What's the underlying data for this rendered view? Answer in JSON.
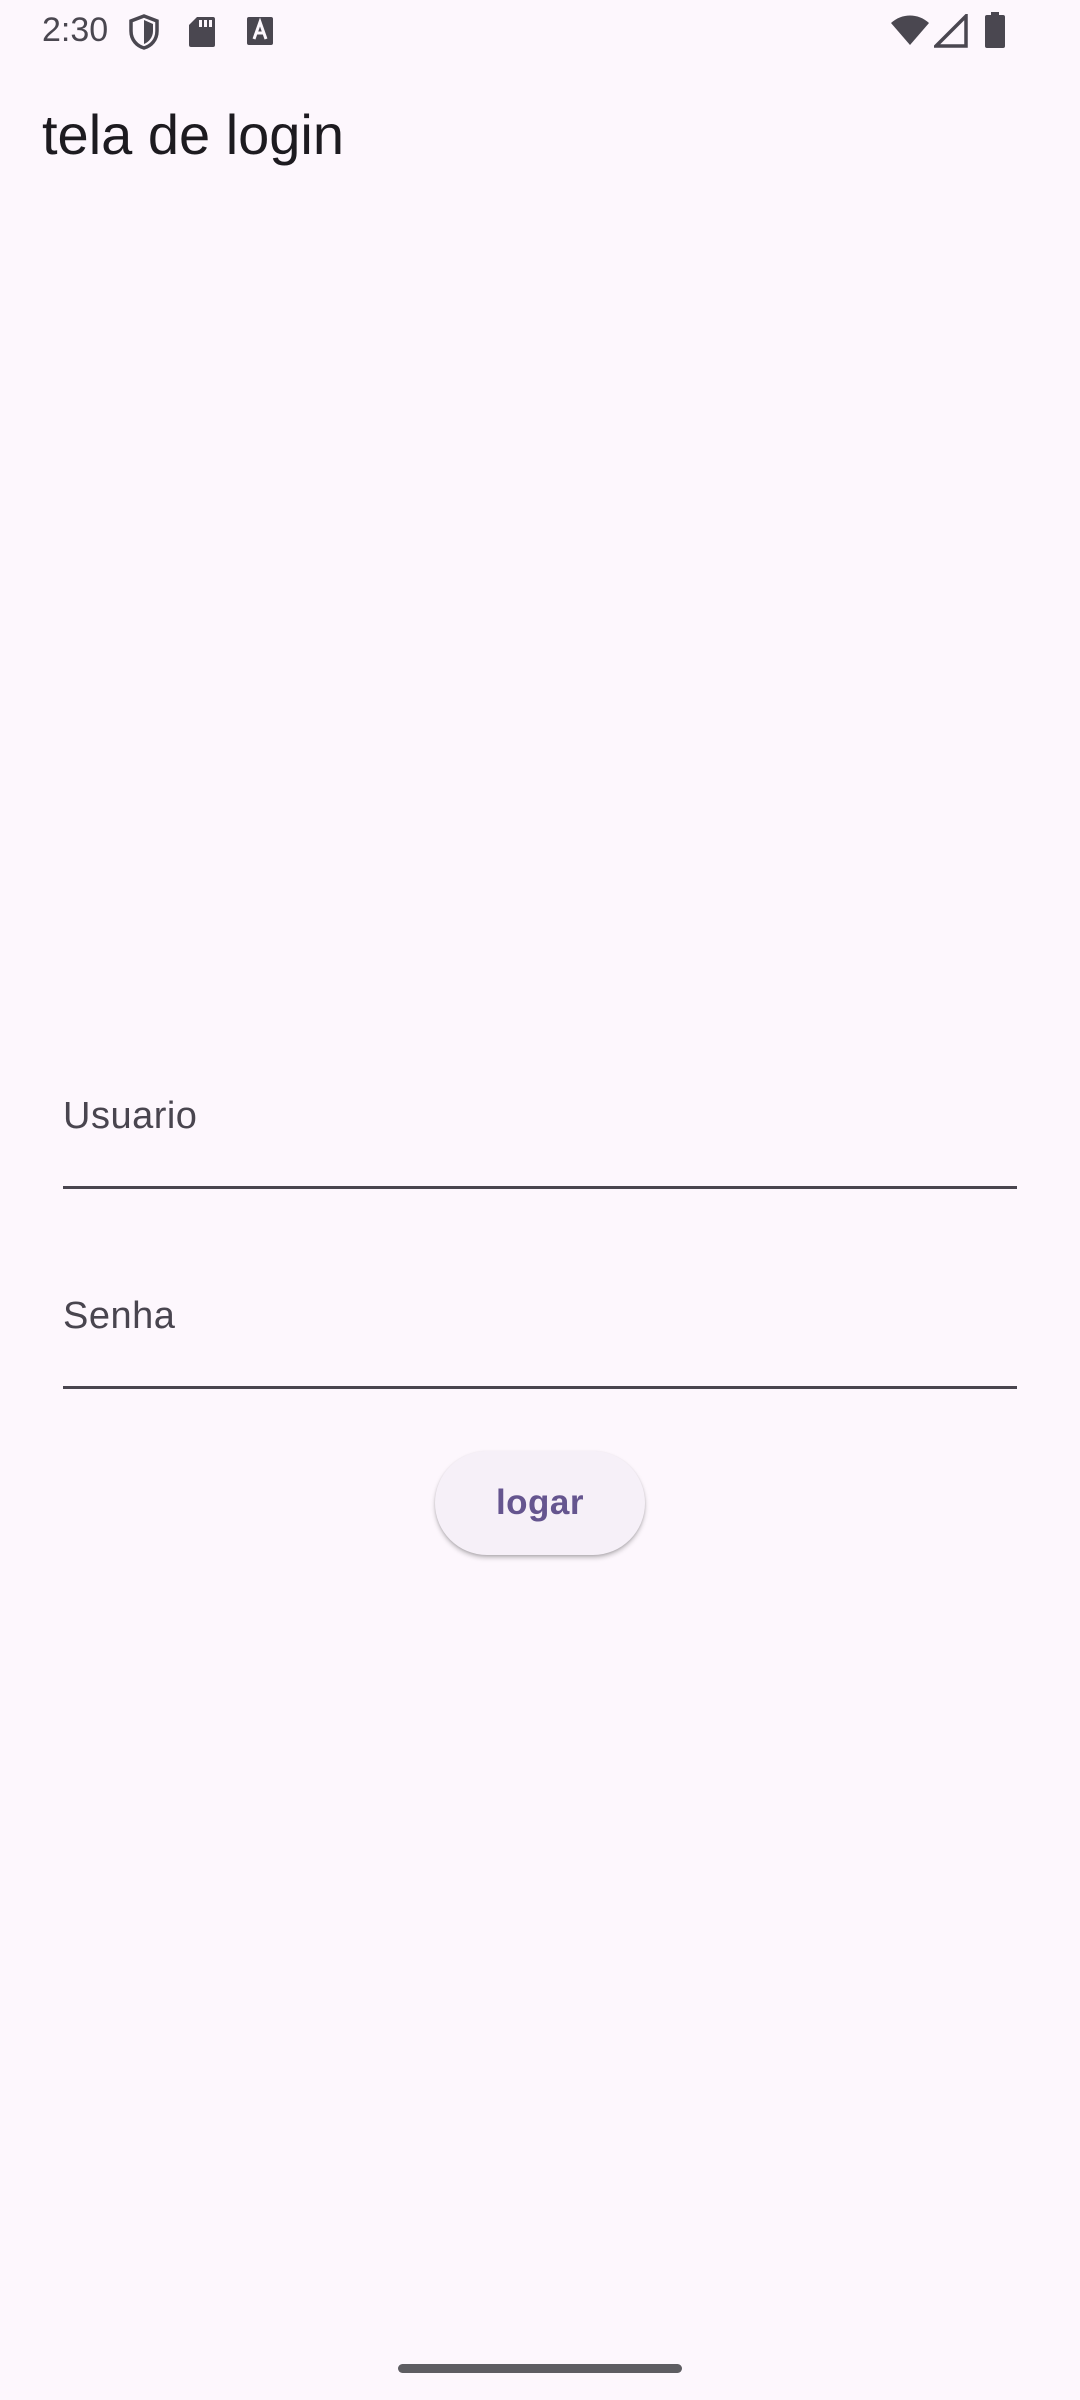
{
  "status_bar": {
    "time": "2:30",
    "icons": [
      "shield-icon",
      "sd-card-icon",
      "font-a-icon",
      "wifi-icon",
      "cell-signal-icon",
      "battery-icon"
    ]
  },
  "app_bar": {
    "title": "tela de login"
  },
  "form": {
    "username": {
      "label": "Usuario",
      "value": ""
    },
    "password": {
      "label": "Senha",
      "value": ""
    },
    "login_button": {
      "label": "logar"
    }
  },
  "colors": {
    "background": "#fdf7fd",
    "primary": "#65558f",
    "button_surface": "#f6f0f8",
    "underline": "#49454f"
  }
}
